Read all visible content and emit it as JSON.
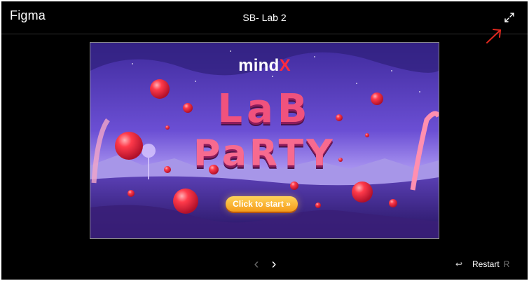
{
  "app": {
    "brand": "Figma",
    "title": "SB- Lab 2"
  },
  "toolbar": {
    "fullscreen_icon": "expand-icon"
  },
  "annotation": {
    "color": "#e0281e",
    "icon": "arrow-icon"
  },
  "slide": {
    "logo_text": "mind",
    "logo_accent": "X",
    "headline_top": "LaB",
    "headline_bottom": "PaRTY",
    "cta_label": "Click  to start »",
    "colors": {
      "sky_top": "#4b2fa8",
      "sky_bottom": "#c9b8ff",
      "balloon": "#ff3a4a",
      "cta": "#f7b12a"
    }
  },
  "nav": {
    "prev_icon": "chevron-left-icon",
    "next_icon": "chevron-right-icon"
  },
  "restart": {
    "label": "Restart",
    "shortcut": "R",
    "icon": "undo-arrow-icon"
  }
}
